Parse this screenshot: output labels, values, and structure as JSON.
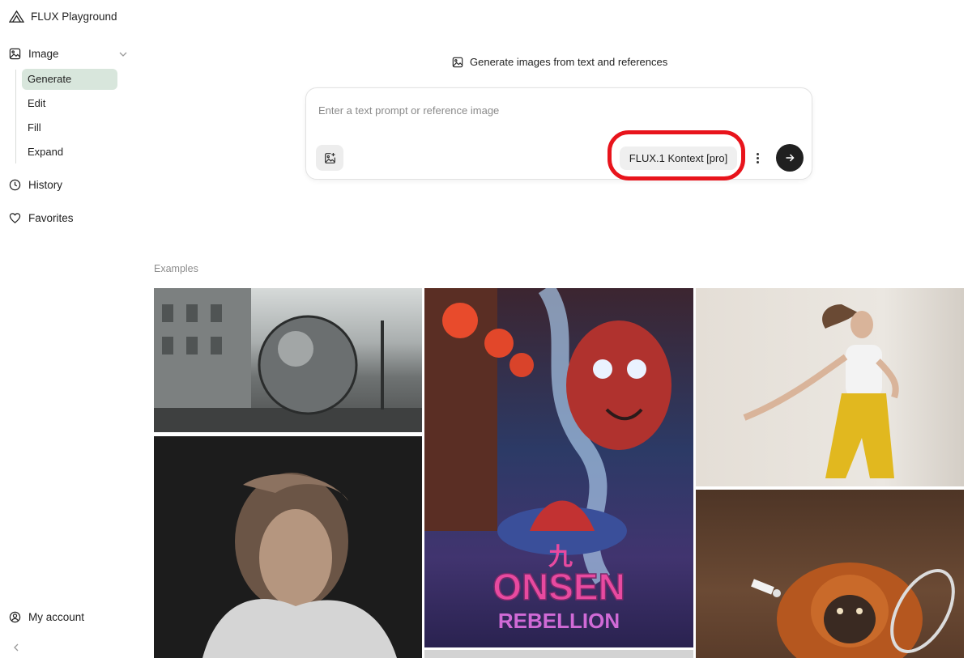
{
  "app": {
    "title": "FLUX Playground"
  },
  "sidebar": {
    "image_section": {
      "label": "Image"
    },
    "subitems": [
      {
        "label": "Generate",
        "active": true
      },
      {
        "label": "Edit",
        "active": false
      },
      {
        "label": "Fill",
        "active": false
      },
      {
        "label": "Expand",
        "active": false
      }
    ],
    "history": {
      "label": "History"
    },
    "favorites": {
      "label": "Favorites"
    },
    "account": {
      "label": "My account"
    }
  },
  "main": {
    "headline": "Generate images from text and references",
    "prompt": {
      "placeholder": "Enter a text prompt or reference image",
      "value": ""
    },
    "model_selector": {
      "label": "FLUX.1 Kontext [pro]"
    },
    "examples_label": "Examples"
  },
  "colors": {
    "active_nav_bg": "#d8e6dc",
    "highlight_ring": "#e8141c",
    "send_button": "#202020"
  }
}
